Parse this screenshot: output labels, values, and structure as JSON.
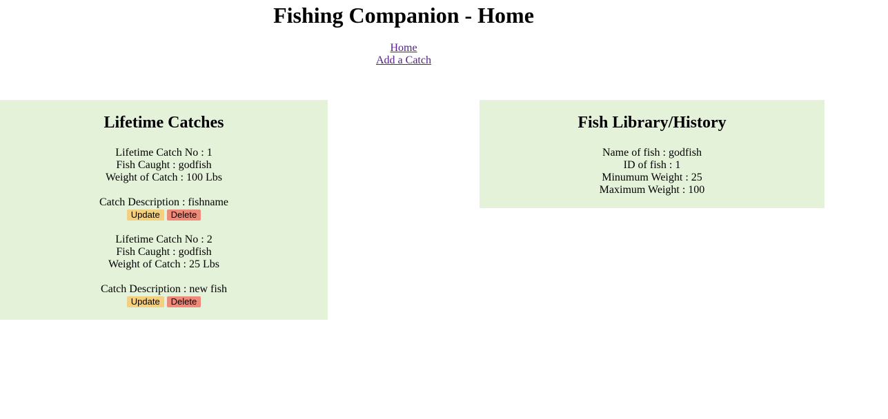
{
  "header": {
    "title": "Fishing Companion - Home"
  },
  "nav": {
    "home": "Home",
    "add_catch": "Add a Catch"
  },
  "catches_panel": {
    "title": "Lifetime Catches",
    "catches": [
      {
        "number_line": "Lifetime Catch No : 1",
        "fish_line": "Fish Caught : godfish",
        "weight_line": "Weight of Catch : 100 Lbs",
        "description_line": "Catch Description : fishname",
        "update_label": "Update",
        "delete_label": "Delete"
      },
      {
        "number_line": "Lifetime Catch No : 2",
        "fish_line": "Fish Caught : godfish",
        "weight_line": "Weight of Catch : 25 Lbs",
        "description_line": "Catch Description : new fish",
        "update_label": "Update",
        "delete_label": "Delete"
      }
    ]
  },
  "library_panel": {
    "title": "Fish Library/History",
    "fish": [
      {
        "name_line": "Name of fish : godfish",
        "id_line": "ID of fish : 1",
        "min_line": "Minumum Weight : 25",
        "max_line": "Maximum Weight : 100"
      }
    ]
  },
  "colors": {
    "panel_background": "#e5f2da",
    "update_button": "#f3cf80",
    "delete_button": "#ee8a7a",
    "link": "#551a8b"
  }
}
